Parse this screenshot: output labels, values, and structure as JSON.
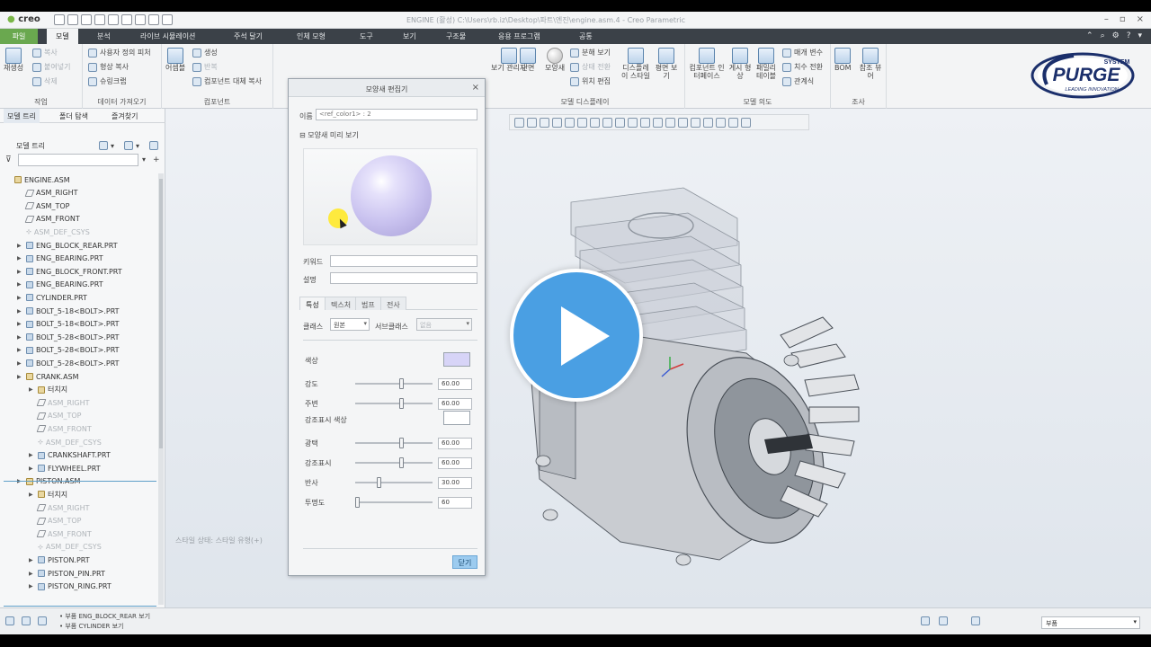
{
  "app": {
    "logo": "creo",
    "window_title": "ENGINE (활성) C:\\Users\\rb.iz\\Desktop\\파트\\엔진\\engine.asm.4 - Creo Parametric"
  },
  "menubar": {
    "tabs": [
      "파일",
      "모델",
      "분석",
      "라이브 시뮬레이션",
      "주석 달기",
      "인체 모형",
      "도구",
      "보기",
      "구조물",
      "응용 프로그램",
      "공통"
    ]
  },
  "ribbon": {
    "groups": {
      "operations": {
        "label": "작업",
        "items": [
          "재생성",
          "복사",
          "붙여넣기",
          "삭제"
        ]
      },
      "get_data": {
        "label": "데이터 가져오기",
        "items": [
          "사용자 정의 피처",
          "형상 복사",
          "슈링크랩"
        ]
      },
      "component": {
        "label": "컴포넌트",
        "items": [
          "어셈블",
          "생성",
          "반복",
          "컴포넌트 대체 복사"
        ]
      },
      "display": {
        "label": "모델 디스플레이",
        "items": [
          "보기 관리자",
          "단면",
          "모양새",
          "분해 보기",
          "상태 전환",
          "위치 편집",
          "디스플레이 스타일",
          "평면 보기"
        ]
      },
      "model_intent": {
        "label": "모델 의도",
        "items": [
          "컴포넌트 인터페이스",
          "게시 형상",
          "패밀리 테이블",
          "매개 변수",
          "치수 전환",
          "관계식"
        ]
      },
      "investigate": {
        "label": "조사",
        "items": [
          "BOM",
          "참조 뷰어"
        ]
      }
    },
    "brand": {
      "name": "PURGE",
      "top": "SYSTEM",
      "tagline": "LEADING INNOVATION",
      "color": "#1b2f6b"
    }
  },
  "left_panel": {
    "tabs": [
      "모델 트리",
      "폴더 탐색",
      "즐겨찾기"
    ],
    "tree_label": "모델 트리",
    "search_placeholder": "",
    "items": [
      {
        "label": "ENGINE.ASM",
        "type": "asm",
        "level": 0,
        "expandable": false,
        "dim": false
      },
      {
        "label": "ASM_RIGHT",
        "type": "plane",
        "level": 1,
        "expandable": false,
        "dim": false
      },
      {
        "label": "ASM_TOP",
        "type": "plane",
        "level": 1,
        "expandable": false,
        "dim": false
      },
      {
        "label": "ASM_FRONT",
        "type": "plane",
        "level": 1,
        "expandable": false,
        "dim": false
      },
      {
        "label": "ASM_DEF_CSYS",
        "type": "csys",
        "level": 1,
        "expandable": false,
        "dim": true
      },
      {
        "label": "ENG_BLOCK_REAR.PRT",
        "type": "prt",
        "level": 1,
        "expandable": true,
        "dim": false
      },
      {
        "label": "ENG_BEARING.PRT",
        "type": "prt",
        "level": 1,
        "expandable": true,
        "dim": false
      },
      {
        "label": "ENG_BLOCK_FRONT.PRT",
        "type": "prt",
        "level": 1,
        "expandable": true,
        "dim": false
      },
      {
        "label": "ENG_BEARING.PRT",
        "type": "prt",
        "level": 1,
        "expandable": true,
        "dim": false
      },
      {
        "label": "CYLINDER.PRT",
        "type": "prt",
        "level": 1,
        "expandable": true,
        "dim": false
      },
      {
        "label": "BOLT_5-18<BOLT>.PRT",
        "type": "prt",
        "level": 1,
        "expandable": true,
        "dim": false
      },
      {
        "label": "BOLT_5-18<BOLT>.PRT",
        "type": "prt",
        "level": 1,
        "expandable": true,
        "dim": false
      },
      {
        "label": "BOLT_5-28<BOLT>.PRT",
        "type": "prt",
        "level": 1,
        "expandable": true,
        "dim": false
      },
      {
        "label": "BOLT_5-28<BOLT>.PRT",
        "type": "prt",
        "level": 1,
        "expandable": true,
        "dim": false
      },
      {
        "label": "BOLT_5-28<BOLT>.PRT",
        "type": "prt",
        "level": 1,
        "expandable": true,
        "dim": false
      },
      {
        "label": "CRANK.ASM",
        "type": "asm",
        "level": 1,
        "expandable": true,
        "dim": false
      },
      {
        "label": "터치지",
        "type": "asm",
        "level": 2,
        "expandable": true,
        "dim": false
      },
      {
        "label": "ASM_RIGHT",
        "type": "plane",
        "level": 2,
        "expandable": false,
        "dim": true
      },
      {
        "label": "ASM_TOP",
        "type": "plane",
        "level": 2,
        "expandable": false,
        "dim": true
      },
      {
        "label": "ASM_FRONT",
        "type": "plane",
        "level": 2,
        "expandable": false,
        "dim": true
      },
      {
        "label": "ASM_DEF_CSYS",
        "type": "csys",
        "level": 2,
        "expandable": false,
        "dim": true
      },
      {
        "label": "CRANKSHAFT.PRT",
        "type": "prt",
        "level": 2,
        "expandable": true,
        "dim": false
      },
      {
        "label": "FLYWHEEL.PRT",
        "type": "prt",
        "level": 2,
        "expandable": true,
        "dim": false
      },
      {
        "label": "PISTON.ASM",
        "type": "asm",
        "level": 1,
        "expandable": true,
        "dim": false
      },
      {
        "label": "터치지",
        "type": "asm",
        "level": 2,
        "expandable": true,
        "dim": false
      },
      {
        "label": "ASM_RIGHT",
        "type": "plane",
        "level": 2,
        "expandable": false,
        "dim": true
      },
      {
        "label": "ASM_TOP",
        "type": "plane",
        "level": 2,
        "expandable": false,
        "dim": true
      },
      {
        "label": "ASM_FRONT",
        "type": "plane",
        "level": 2,
        "expandable": false,
        "dim": true
      },
      {
        "label": "ASM_DEF_CSYS",
        "type": "csys",
        "level": 2,
        "expandable": false,
        "dim": true
      },
      {
        "label": "PISTON.PRT",
        "type": "prt",
        "level": 2,
        "expandable": true,
        "dim": false
      },
      {
        "label": "PISTON_PIN.PRT",
        "type": "prt",
        "level": 2,
        "expandable": true,
        "dim": false
      },
      {
        "label": "PISTON_RING.PRT",
        "type": "prt",
        "level": 2,
        "expandable": true,
        "dim": false
      }
    ]
  },
  "canvas": {
    "note": "스타일 상태: 스타일 유형(+)"
  },
  "dialog": {
    "title": "모양새 편집기",
    "name_label": "이름",
    "name_value": "<ref_color1> : 2",
    "preview_label": "모양새 미리 보기",
    "keyword_label": "키워드",
    "keyword_value": "",
    "desc_label": "설명",
    "desc_value": "",
    "tabs": [
      "특성",
      "텍스처",
      "범프",
      "전사"
    ],
    "class_label": "클래스",
    "class_value": "원본",
    "subclass_label": "서브클래스",
    "subclass_value": "없음",
    "color_label": "색상",
    "color_value": "#d7d4f7",
    "highlight_color_label": "강조표시 색상",
    "highlight_color_value": "#ffffff",
    "properties": [
      {
        "label": "강도",
        "value": "60.00",
        "fraction": 0.6
      },
      {
        "label": "주변",
        "value": "60.00",
        "fraction": 0.6
      },
      {
        "label": "광택",
        "value": "60.00",
        "fraction": 0.6
      },
      {
        "label": "강조표시",
        "value": "60.00",
        "fraction": 0.6
      },
      {
        "label": "반사",
        "value": "30.00",
        "fraction": 0.3
      },
      {
        "label": "투명도",
        "value": "60",
        "fraction": 0.0
      }
    ],
    "close_button": "닫기"
  },
  "status": {
    "messages": [
      "• 부품 ENG_BLOCK_REAR 보기",
      "• 부품 CYLINDER 보기"
    ],
    "filter_value": "부품"
  },
  "overlay": {
    "color": "#4a9fe3"
  }
}
